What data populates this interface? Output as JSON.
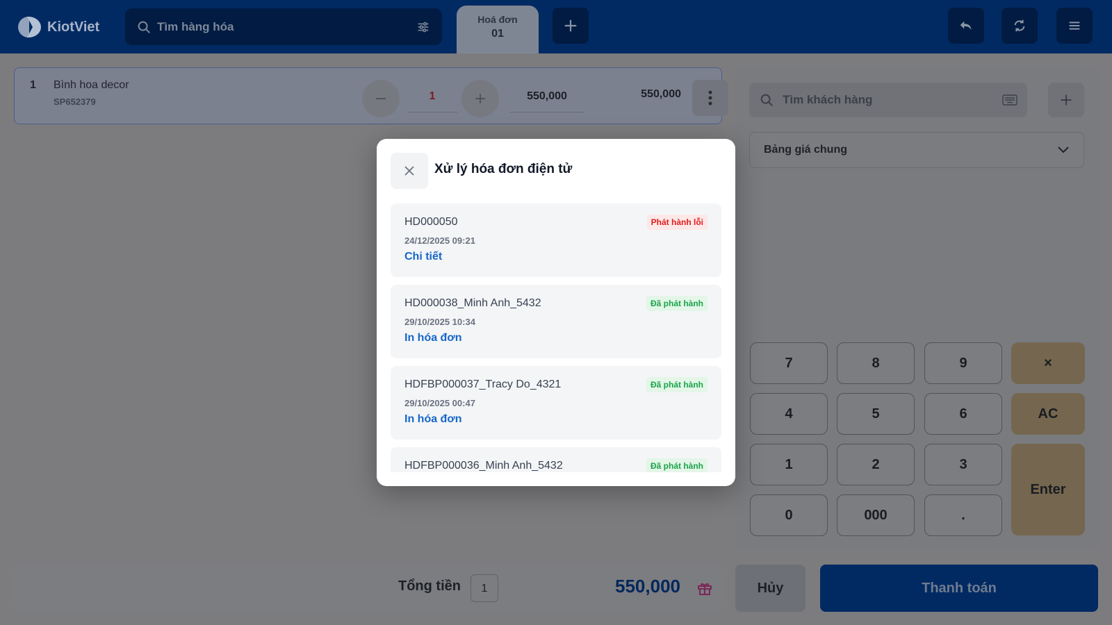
{
  "header": {
    "brand": "KiotViet",
    "search_placeholder": "Tìm hàng hóa",
    "tab": {
      "label": "Hoá đơn",
      "number": "01"
    }
  },
  "cart": {
    "items": [
      {
        "index": "1",
        "name": "Bình hoa decor",
        "code": "SP652379",
        "qty": "1",
        "price": "550,000",
        "total": "550,000"
      }
    ]
  },
  "customer": {
    "search_placeholder": "Tìm khách hàng",
    "price_list": "Bảng giá chung"
  },
  "keypad": {
    "keys": [
      "7",
      "8",
      "9",
      "×",
      "4",
      "5",
      "6",
      "AC",
      "1",
      "2",
      "3",
      "Enter",
      "0",
      "000",
      "."
    ]
  },
  "footer": {
    "total_label": "Tổng tiền",
    "item_count": "1",
    "total_amount": "550,000",
    "cancel_label": "Hủy",
    "pay_label": "Thanh toán"
  },
  "modal": {
    "title": "Xử lý hóa đơn điện tử",
    "invoices": [
      {
        "code": "HD000050",
        "date": "24/12/2025 09:21",
        "status": "Phát hành lỗi",
        "status_type": "error",
        "action": "Chi tiết"
      },
      {
        "code": "HD000038_Minh Anh_5432",
        "date": "29/10/2025 10:34",
        "status": "Đã phát hành",
        "status_type": "ok",
        "action": "In hóa đơn"
      },
      {
        "code": "HDFBP000037_Tracy Do_4321",
        "date": "29/10/2025 00:47",
        "status": "Đã phát hành",
        "status_type": "ok",
        "action": "In hóa đơn"
      },
      {
        "code": "HDFBP000036_Minh Anh_5432",
        "date": "",
        "status": "Đã phát hành",
        "status_type": "ok",
        "action": ""
      }
    ]
  },
  "colors": {
    "brand_navy": "#012a63",
    "link_blue": "#1567c9",
    "error_red": "#e11d1d",
    "success_green": "#1aa34a"
  }
}
